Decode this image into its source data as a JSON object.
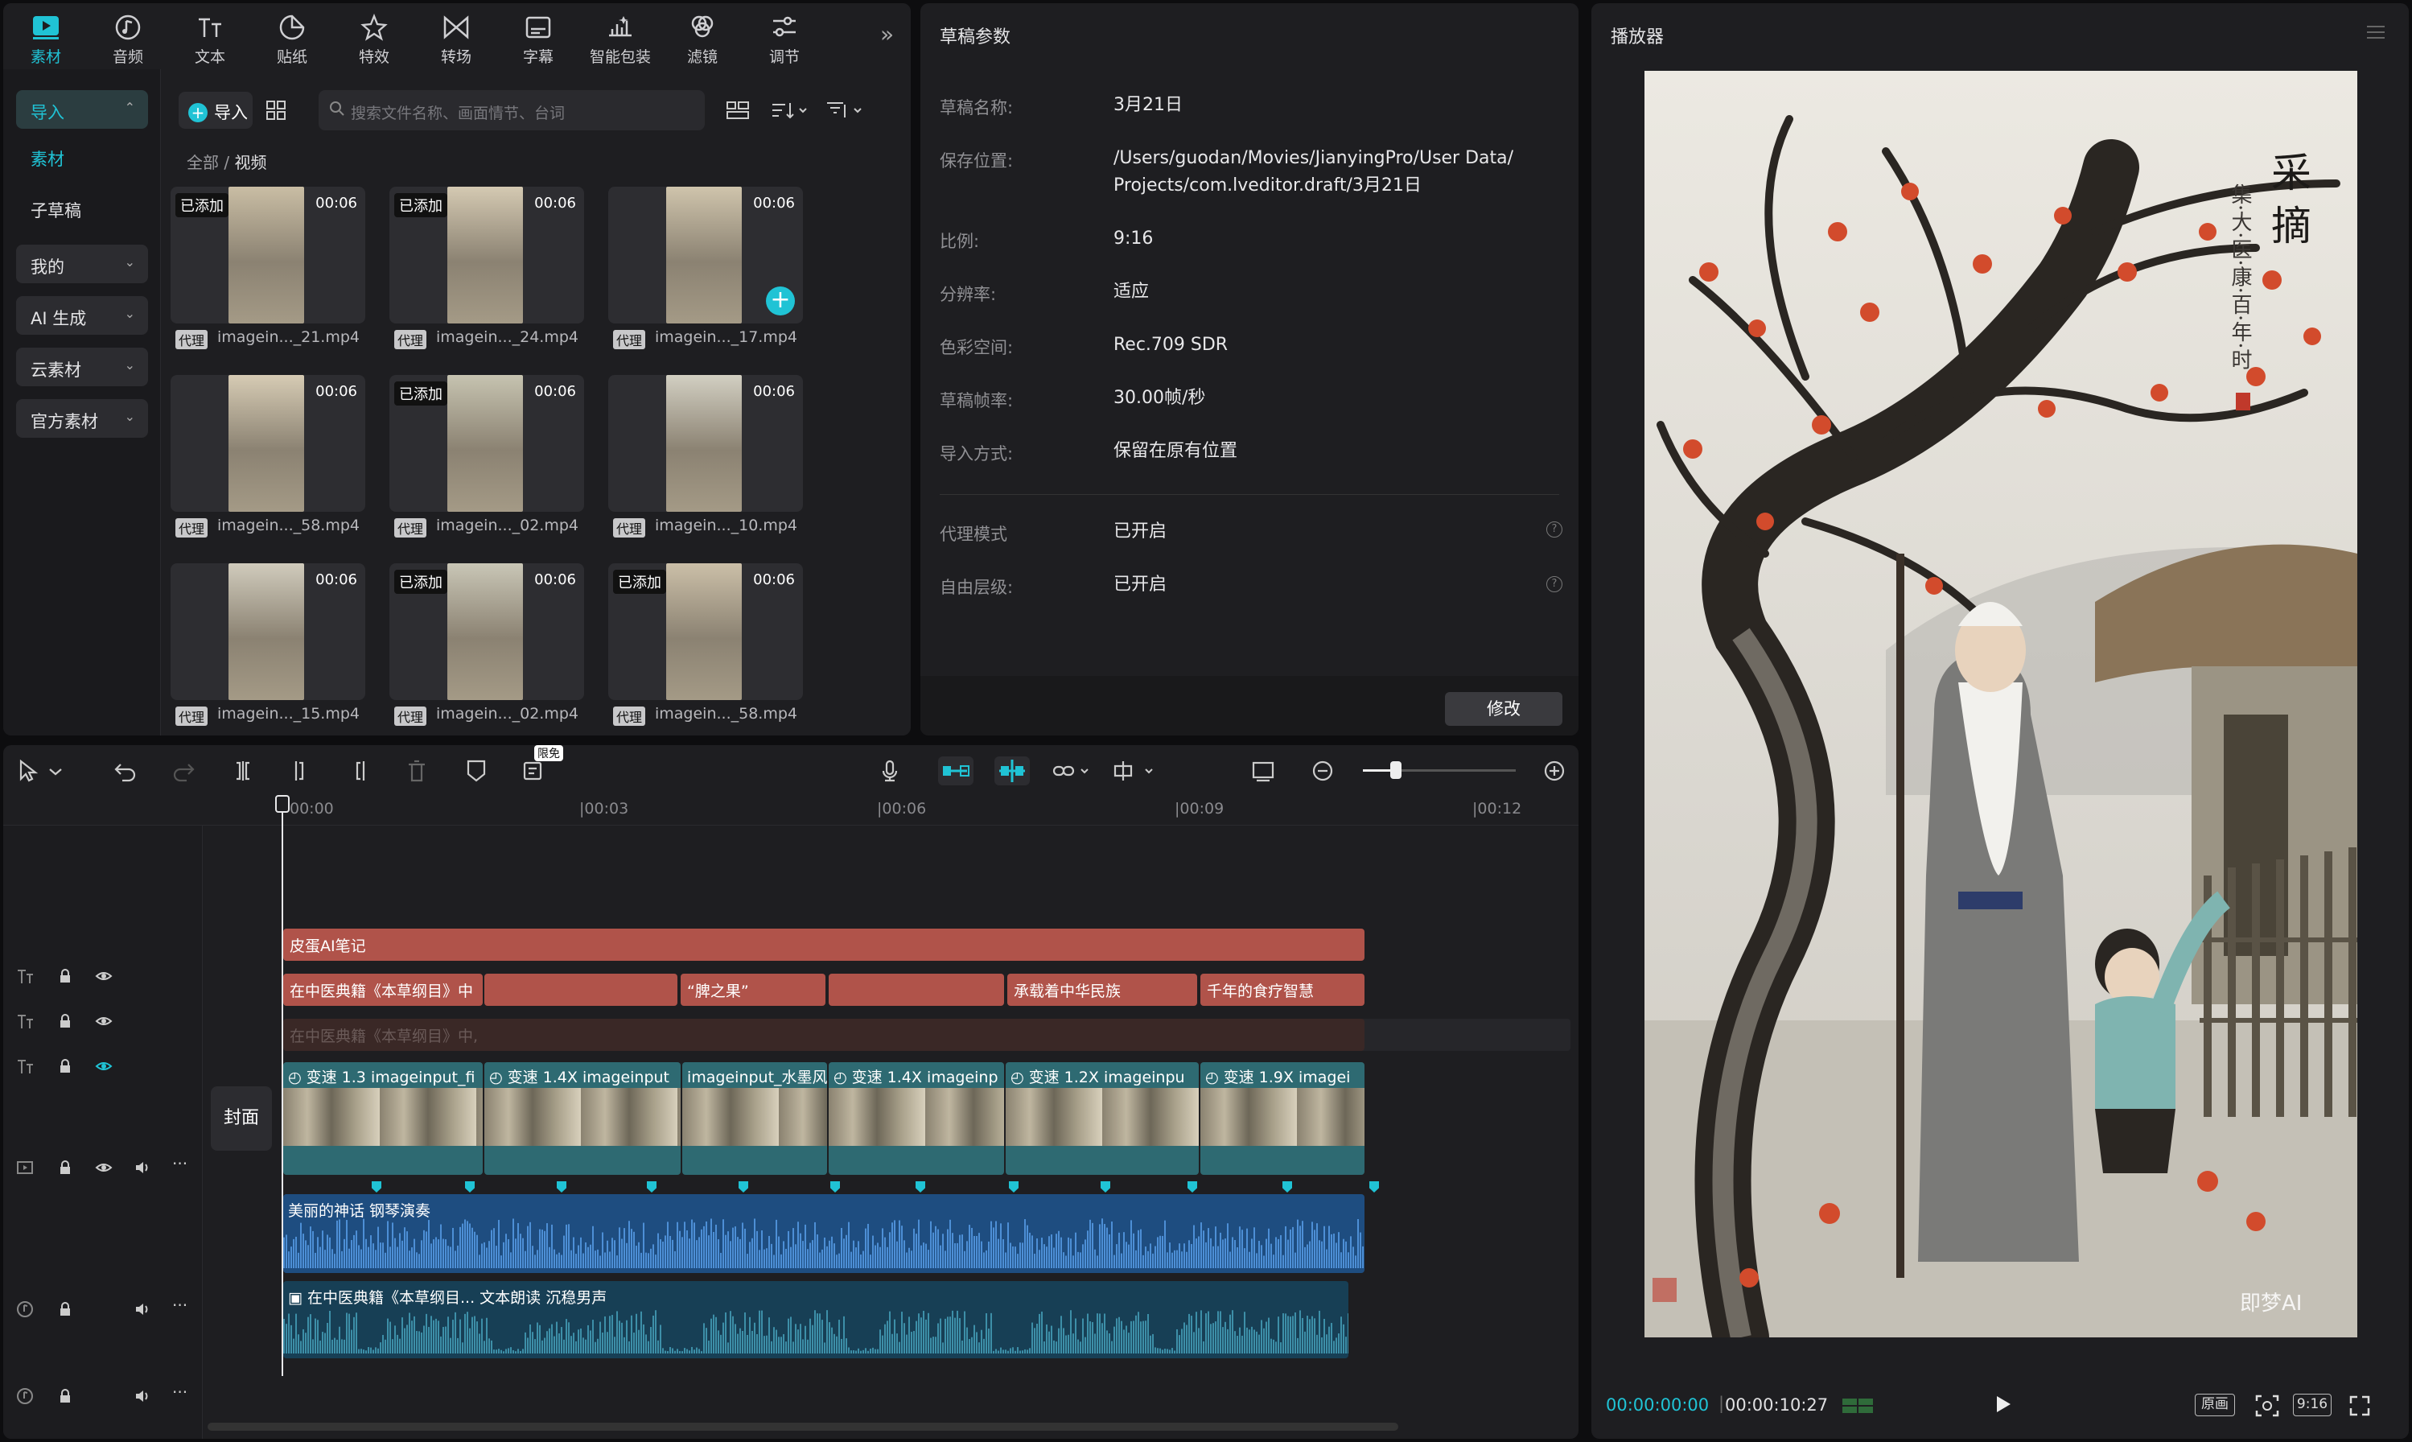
{
  "toolbar": {
    "items": [
      {
        "label": "素材",
        "icon": "media-icon",
        "active": true
      },
      {
        "label": "音频",
        "icon": "audio-icon"
      },
      {
        "label": "文本",
        "icon": "text-icon"
      },
      {
        "label": "贴纸",
        "icon": "sticker-icon"
      },
      {
        "label": "特效",
        "icon": "effects-icon"
      },
      {
        "label": "转场",
        "icon": "transition-icon"
      },
      {
        "label": "字幕",
        "icon": "subtitle-icon"
      },
      {
        "label": "智能包装",
        "icon": "smart-package-icon"
      },
      {
        "label": "滤镜",
        "icon": "filter-icon"
      },
      {
        "label": "调节",
        "icon": "adjust-icon"
      }
    ],
    "more_icon": "double-chevron-right-icon"
  },
  "left_nav": {
    "import": "导入",
    "media": "素材",
    "sub_draft": "子草稿",
    "mine": "我的",
    "ai_gen": "AI 生成",
    "cloud": "云素材",
    "official": "官方素材"
  },
  "media": {
    "import_label": "导入",
    "search_placeholder": "搜索文件名称、画面情节、台词",
    "breadcrumb_root": "全部",
    "breadcrumb_sep": "/",
    "breadcrumb_current": "视频",
    "proxy_tag": "代理",
    "added_tag": "已添加",
    "items": [
      {
        "file": "imagein..._21.mp4",
        "duration": "00:06",
        "added": true
      },
      {
        "file": "imagein..._24.mp4",
        "duration": "00:06",
        "added": true
      },
      {
        "file": "imagein..._17.mp4",
        "duration": "00:06",
        "added": false
      },
      {
        "file": "imagein..._58.mp4",
        "duration": "00:06",
        "added": false
      },
      {
        "file": "imagein..._02.mp4",
        "duration": "00:06",
        "added": true
      },
      {
        "file": "imagein..._10.mp4",
        "duration": "00:06",
        "added": false
      },
      {
        "file": "imagein..._15.mp4",
        "duration": "00:06",
        "added": false
      },
      {
        "file": "imagein..._02.mp4",
        "duration": "00:06",
        "added": true
      },
      {
        "file": "imagein..._58.mp4",
        "duration": "00:06",
        "added": true
      }
    ]
  },
  "draft": {
    "title": "草稿参数",
    "name_label": "草稿名称:",
    "name": "3月21日",
    "location_label": "保存位置:",
    "location_1": "/Users/guodan/Movies/JianyingPro/User Data/",
    "location_2": "Projects/com.lveditor.draft/3月21日",
    "ratio_label": "比例:",
    "ratio": "9:16",
    "resolution_label": "分辨率:",
    "resolution": "适应",
    "colorspace_label": "色彩空间:",
    "colorspace": "Rec.709 SDR",
    "fps_label": "草稿帧率:",
    "fps": "30.00帧/秒",
    "import_mode_label": "导入方式:",
    "import_mode": "保留在原有位置",
    "proxy_label": "代理模式",
    "proxy": "已开启",
    "layer_label": "自由层级:",
    "layer": "已开启",
    "modify": "修改"
  },
  "player": {
    "title": "播放器",
    "current_time": "00:00:00:00",
    "total_time": "00:00:10:27",
    "original_btn": "原画",
    "ratio_btn": "9:16",
    "seal_text": "采 摘",
    "seal_sub": "集·大·医·康·百·年·时",
    "watermark": "即梦AI"
  },
  "timeline": {
    "free_badge": "限免",
    "ticks": [
      "00:00",
      "|00:03",
      "|00:06",
      "|00:09",
      "|00:12"
    ],
    "cover": "封面",
    "text_track_1": "皮蛋AI笔记",
    "text_track_2": [
      "在中医典籍《本草纲目》中",
      "“脾之果”",
      "承载着中华民族",
      "千年的食疗智慧"
    ],
    "text_track_3": "在中医典籍《本草纲目》中,",
    "video_clips": [
      {
        "speed": "变速 1.3",
        "name": "imageinput_fi"
      },
      {
        "speed": "变速 1.4X",
        "name": "imageinput"
      },
      {
        "speed": "",
        "name": "imageinput_水墨风"
      },
      {
        "speed": "变速 1.4X",
        "name": "imageinp"
      },
      {
        "speed": "变速 1.2X",
        "name": "imageinpu"
      },
      {
        "speed": "变速 1.9X",
        "name": "imagei"
      }
    ],
    "music_label": "美丽的神话 钢琴演奏",
    "voice_label": "在中医典籍《本草纲目...",
    "voice_sub": "文本朗读 沉稳男声"
  },
  "colors": {
    "accent": "#20c3d5",
    "caption_clip": "#b0534a",
    "video_clip": "#2e6a72",
    "audio_clip": "#1e4d80",
    "voice_clip": "#173f55"
  }
}
